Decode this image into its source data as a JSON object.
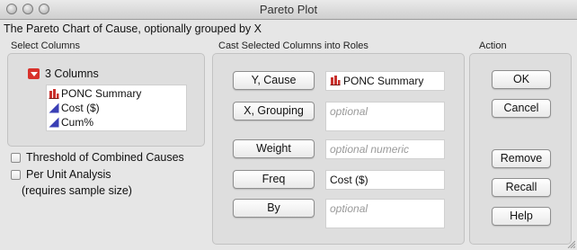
{
  "window": {
    "title": "Pareto Plot",
    "subtitle": "The Pareto Chart of Cause, optionally grouped by X"
  },
  "select_columns": {
    "label": "Select Columns",
    "header": "3 Columns",
    "items": [
      {
        "label": "PONC Summary",
        "icon": "bar-chart-icon"
      },
      {
        "label": "Cost ($)",
        "icon": "continuous-icon"
      },
      {
        "label": "Cum%",
        "icon": "continuous-icon"
      }
    ]
  },
  "options": {
    "threshold": {
      "label": "Threshold of Combined Causes",
      "checked": false
    },
    "per_unit": {
      "label": "Per Unit Analysis",
      "checked": false,
      "note": "(requires sample size)"
    }
  },
  "roles": {
    "label": "Cast Selected Columns into Roles",
    "y_cause": {
      "button": "Y, Cause",
      "value": "PONC Summary"
    },
    "x_grouping": {
      "button": "X, Grouping",
      "placeholder": "optional"
    },
    "weight": {
      "button": "Weight",
      "placeholder": "optional numeric"
    },
    "freq": {
      "button": "Freq",
      "value": "Cost ($)"
    },
    "by": {
      "button": "By",
      "placeholder": "optional"
    }
  },
  "action": {
    "label": "Action",
    "ok": "OK",
    "cancel": "Cancel",
    "remove": "Remove",
    "recall": "Recall",
    "help": "Help"
  },
  "colors": {
    "window_bg": "#e6e6e6",
    "panel_bg": "#dedede",
    "nominal_red": "#c9302c",
    "continuous_blue": "#3a3fb5",
    "menu_red": "#d8312b"
  }
}
